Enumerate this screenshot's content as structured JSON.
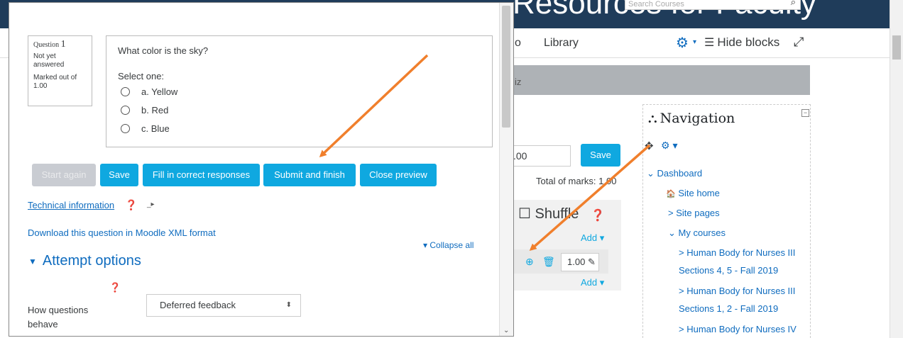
{
  "header": {
    "site_title": "Resources for Faculty",
    "search_placeholder": "Search Courses",
    "search_icon": "search-icon"
  },
  "navbar": {
    "fragment": "o",
    "library": "Library",
    "gear_icon": "gear-icon",
    "hide_blocks": "Hide blocks",
    "expand_icon": "expand-icon"
  },
  "quiz_page": {
    "breadcrumb_fragment": "iz",
    "max_grade_value": ".00",
    "save_label": "Save",
    "total_marks": "Total of marks: 1.00",
    "shuffle_label": "☐ Shuffle",
    "add_label": "Add",
    "slot_mark": "1.00"
  },
  "navigation": {
    "title": "Navigation",
    "items": [
      {
        "label": "Dashboard",
        "prefix": "⌄"
      },
      {
        "label": "Site home",
        "prefix": "🏠"
      },
      {
        "label": "Site pages",
        "prefix": ">"
      },
      {
        "label": "My courses",
        "prefix": "⌄"
      },
      {
        "label": "Human Body for Nurses III",
        "prefix": ">"
      },
      {
        "label": "Sections 4, 5 - Fall 2019",
        "prefix": ""
      },
      {
        "label": "Human Body for Nurses III",
        "prefix": ">"
      },
      {
        "label": "Sections 1, 2 - Fall 2019",
        "prefix": ""
      },
      {
        "label": "Human Body for Nurses IV",
        "prefix": ">"
      }
    ]
  },
  "preview": {
    "question_info": {
      "question_word": "Question",
      "question_number": "1",
      "state": "Not yet answered",
      "marked_out_of": "Marked out of 1.00"
    },
    "question_text": "What color is the sky?",
    "prompt": "Select one:",
    "options": [
      {
        "label": "a. Yellow"
      },
      {
        "label": "b. Red"
      },
      {
        "label": "c. Blue"
      }
    ],
    "buttons": {
      "start_again": "Start again",
      "save": "Save",
      "fill_correct": "Fill in correct responses",
      "submit_finish": "Submit and finish",
      "close_preview": "Close preview"
    },
    "technical_information": "Technical information",
    "download_link": "Download this question in Moodle XML format",
    "collapse_all": "Collapse all",
    "attempt_options": "Attempt options",
    "how_questions_behave": "How questions behave",
    "behaviour_selected": "Deferred feedback"
  },
  "colors": {
    "header_bg": "#1f3c5a",
    "button_bg": "#0fa8e0",
    "link": "#0f6cbf",
    "annotation_arrow": "#f07f2c"
  }
}
